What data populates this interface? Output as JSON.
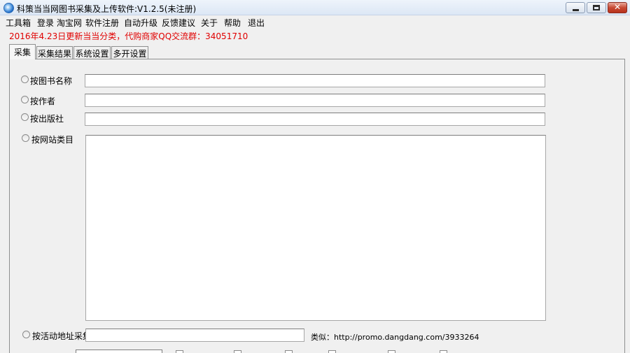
{
  "window": {
    "title": "科策当当网图书采集及上传软件:V1.2.5(未注册)",
    "close_glyph": "✕"
  },
  "menu": [
    "工具箱",
    "登录 淘宝网",
    "软件注册",
    "自动升级",
    "反馈建议",
    "关于",
    "帮助",
    "退出"
  ],
  "notice": "2016年4.23日更新当当分类，代购商家QQ交流群：34051710",
  "tabs": [
    "采集",
    "采集结果",
    "系统设置",
    "多开设置"
  ],
  "form": {
    "by_book_name": {
      "label": "按图书名称",
      "value": ""
    },
    "by_author": {
      "label": "按作者",
      "value": ""
    },
    "by_publisher": {
      "label": "按出版社",
      "value": ""
    },
    "by_category": {
      "label": "按网站类目"
    },
    "by_activity_url": {
      "label": "按活动地址采集",
      "value": ""
    },
    "example": "类似：http://promo.dangdang.com/3933264"
  },
  "colors": {
    "notice": "#e00000",
    "panel_bg": "#f0f0f0",
    "close_button": "#c74a34"
  }
}
